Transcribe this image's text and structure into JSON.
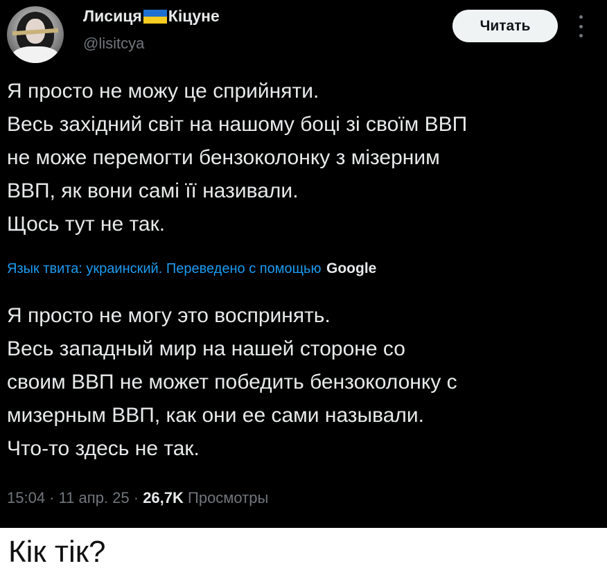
{
  "author": {
    "name_part1": "Лисиця",
    "name_part2": "Кіцуне",
    "flag_icon": "ukraine-flag-icon",
    "handle": "@lisitcya"
  },
  "follow_button_label": "Читать",
  "more_icon": "vertical-ellipsis-icon",
  "original_lines": [
    "Я просто не можу це сприйняти.",
    "Весь західний світ на нашому боці зі своїм ВВП",
    "не може перемогти бензоколонку з мізерним",
    "ВВП, як вони самі її називали.",
    "Щось тут не так."
  ],
  "translation_note": "Язык твита: украинский. Переведено с помощью",
  "translation_provider": "Google",
  "translated_lines": [
    "Я просто не могу это воспринять.",
    "Весь западный мир на нашей стороне со",
    "своим ВВП не может победить бензоколонку с",
    "мизерным ВВП, как они ее сами называли.",
    "Что-то здесь не так."
  ],
  "meta": {
    "time_date": "15:04 · 11 апр. 25 · ",
    "views_count": "26,7K",
    "views_label": " Просмотры"
  },
  "caption": "Кік тік?",
  "colors": {
    "background": "#000000",
    "link_blue": "#1d9bf0",
    "muted": "#71767b"
  }
}
